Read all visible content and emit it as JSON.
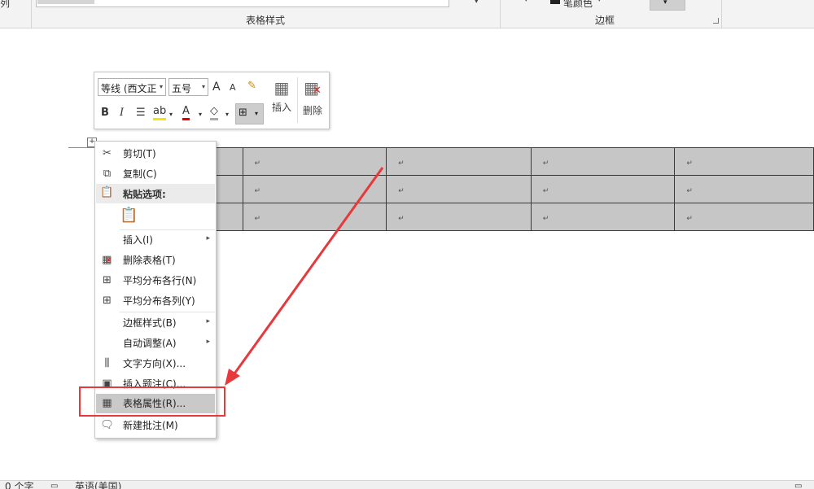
{
  "ribbon": {
    "left_fragment": "列",
    "table_styles_label": "表格样式",
    "borders_label": "边框",
    "pen_color_label": "笔颜色",
    "scroll_arrow": "▾",
    "small_arrow": "▾"
  },
  "mini_toolbar": {
    "font_name": "等线 (西文正",
    "font_size": "五号",
    "grow_font": "A",
    "shrink_font": "A",
    "bold": "B",
    "italic": "I",
    "insert_label": "插入",
    "delete_label": "删除",
    "dropdown_glyph": "▾"
  },
  "context_menu": {
    "items": [
      {
        "label": "剪切(T)",
        "icon": "scissors-icon"
      },
      {
        "label": "复制(C)",
        "icon": "copy-icon"
      },
      {
        "label": "粘贴选项:",
        "icon": "clipboard-icon"
      },
      {
        "label": "插入(I)",
        "icon": "none",
        "submenu": true
      },
      {
        "label": "删除表格(T)",
        "icon": "delete-table-icon"
      },
      {
        "label": "平均分布各行(N)",
        "icon": "distribute-rows-icon"
      },
      {
        "label": "平均分布各列(Y)",
        "icon": "distribute-columns-icon"
      },
      {
        "label": "边框样式(B)",
        "icon": "none",
        "submenu": true
      },
      {
        "label": "自动调整(A)",
        "icon": "none",
        "submenu": true
      },
      {
        "label": "文字方向(X)...",
        "icon": "text-direction-icon"
      },
      {
        "label": "插入题注(C)...",
        "icon": "caption-icon"
      },
      {
        "label": "表格属性(R)...",
        "icon": "table-properties-icon",
        "highlighted": true
      },
      {
        "label": "新建批注(M)",
        "icon": "comment-icon"
      }
    ],
    "submenu_arrow": "▸"
  },
  "table": {
    "cell_mark": "↵",
    "rows": 3,
    "columns": 5
  },
  "status_bar": {
    "word_count": "0 个字",
    "language": "英语(美国)"
  },
  "colors": {
    "annotation_red": "#e8383b",
    "table_fill": "#c6c6c6",
    "menu_highlight": "#c9c9c9"
  }
}
